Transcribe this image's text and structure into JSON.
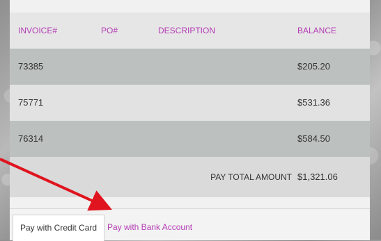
{
  "table": {
    "headers": {
      "invoice": "INVOICE#",
      "po": "PO#",
      "description": "DESCRIPTION",
      "balance": "BALANCE"
    },
    "rows": [
      {
        "invoice": "73385",
        "po": "",
        "description": "",
        "balance": "$205.20"
      },
      {
        "invoice": "75771",
        "po": "",
        "description": "",
        "balance": "$531.36"
      },
      {
        "invoice": "76314",
        "po": "",
        "description": "",
        "balance": "$584.50"
      }
    ],
    "total": {
      "label": "PAY TOTAL AMOUNT",
      "value": "$1,321.06"
    }
  },
  "tabs": {
    "credit_card": "Pay with Credit Card",
    "bank_account": "Pay with Bank Account"
  },
  "colors": {
    "accent": "#b43cb4",
    "annotation_arrow": "#e0141e"
  }
}
